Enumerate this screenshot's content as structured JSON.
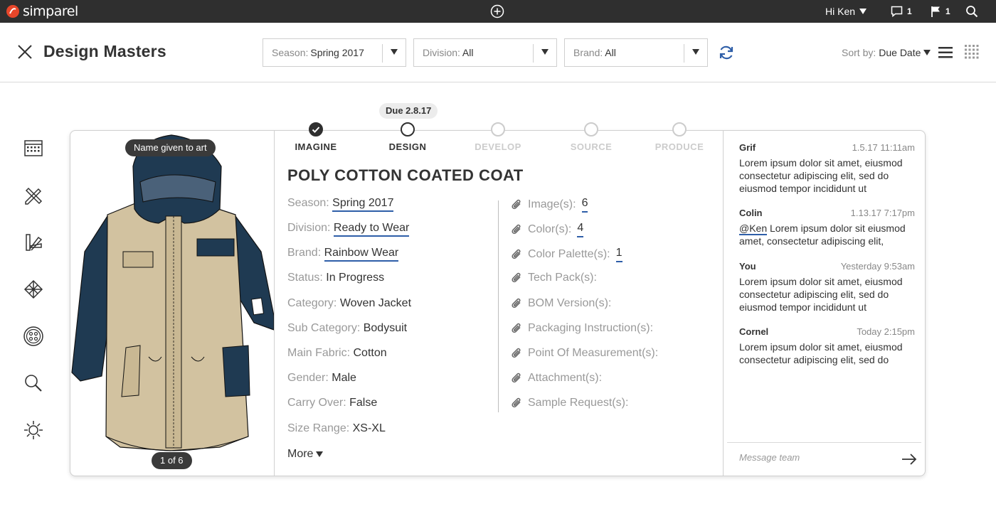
{
  "topbar": {
    "logo_text": "simparel",
    "greeting": "Hi Ken",
    "messages_count": "1",
    "flags_count": "1"
  },
  "header": {
    "title": "Design Masters",
    "filters": [
      {
        "label": "Season:",
        "value": "Spring 2017"
      },
      {
        "label": "Division:",
        "value": "All"
      },
      {
        "label": "Brand:",
        "value": "All"
      }
    ],
    "sort_label": "Sort by:",
    "sort_value": "Due Date"
  },
  "card": {
    "art_name": "Name given to art",
    "art_pager": "1 of 6",
    "due": "Due 2.8.17",
    "steps": [
      {
        "label": "IMAGINE",
        "state": "done"
      },
      {
        "label": "DESIGN",
        "state": "current"
      },
      {
        "label": "DEVELOP",
        "state": "todo"
      },
      {
        "label": "SOURCE",
        "state": "todo"
      },
      {
        "label": "PRODUCE",
        "state": "todo"
      }
    ],
    "title": "POLY COTTON COATED COAT",
    "fields": [
      {
        "key": "Season:",
        "value": "Spring 2017",
        "link": true
      },
      {
        "key": "Division:",
        "value": "Ready to Wear",
        "link": true
      },
      {
        "key": "Brand:",
        "value": "Rainbow Wear",
        "link": true
      },
      {
        "key": "Status:",
        "value": "In Progress",
        "link": false
      },
      {
        "key": "Category:",
        "value": "Woven Jacket",
        "link": false
      },
      {
        "key": "Sub Category:",
        "value": "Bodysuit",
        "link": false
      },
      {
        "key": "Main Fabric:",
        "value": "Cotton",
        "link": false
      },
      {
        "key": "Gender:",
        "value": "Male",
        "link": false
      },
      {
        "key": "Carry Over:",
        "value": "False",
        "link": false
      },
      {
        "key": "Size Range:",
        "value": "XS-XL",
        "link": false
      }
    ],
    "more_label": "More",
    "attachments": [
      {
        "key": "Image(s):",
        "value": "6"
      },
      {
        "key": "Color(s):",
        "value": "4"
      },
      {
        "key": "Color Palette(s):",
        "value": "1"
      },
      {
        "key": "Tech Pack(s):",
        "value": ""
      },
      {
        "key": "BOM Version(s):",
        "value": ""
      },
      {
        "key": "Packaging Instruction(s):",
        "value": ""
      },
      {
        "key": "Point Of Measurement(s):",
        "value": ""
      },
      {
        "key": "Attachment(s):",
        "value": ""
      },
      {
        "key": "Sample Request(s):",
        "value": ""
      }
    ],
    "messages": [
      {
        "name": "Grif",
        "time": "1.5.17 11:11am",
        "mention": "",
        "body": "Lorem ipsum dolor sit amet, eiusmod consectetur adipiscing elit, sed do eiusmod tempor incididunt ut"
      },
      {
        "name": "Colin",
        "time": "1.13.17 7:17pm",
        "mention": "@Ken",
        "body": " Lorem ipsum dolor sit eiusmod amet, consectetur adipiscing elit,"
      },
      {
        "name": "You",
        "time": "Yesterday 9:53am",
        "mention": "",
        "body": "Lorem ipsum dolor sit amet, eiusmod consectetur adipiscing elit, sed do eiusmod tempor incididunt ut"
      },
      {
        "name": "Cornel",
        "time": "Today 2:15pm",
        "mention": "",
        "body": "Lorem ipsum dolor sit amet, eiusmod consectetur adipiscing elit, sed do"
      }
    ],
    "message_placeholder": "Message team"
  },
  "colors": {
    "topbar": "#2f2f2f",
    "logo": "#e8462a",
    "link_underline": "#2e5ea8",
    "refresh": "#2e5ea8",
    "coat_navy": "#1f3a52",
    "coat_khaki": "#d2c2a0"
  },
  "icons": {
    "rail": [
      "calendar-icon",
      "design-tools-icon",
      "color-palette-icon",
      "pattern-icon",
      "button-icon",
      "search-icon",
      "sun-icon"
    ]
  }
}
